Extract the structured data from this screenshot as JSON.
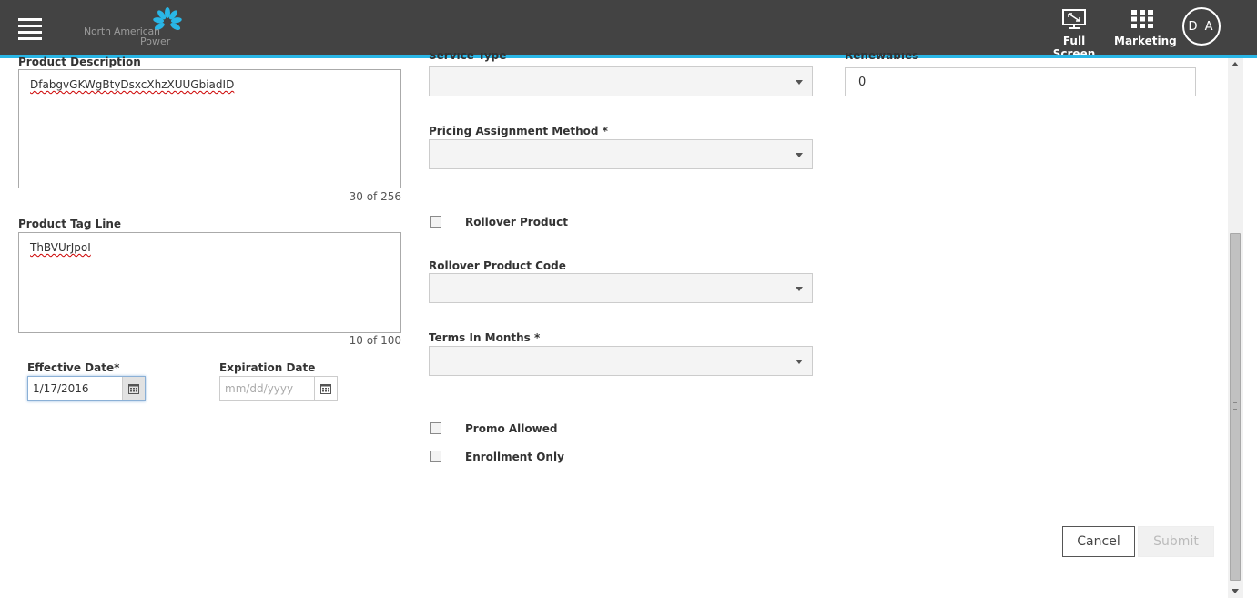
{
  "header": {
    "menu_icon": "hamburger-menu-icon",
    "logo": {
      "line1": "North American",
      "line2": "Power",
      "icon": "flower-burst-logo",
      "accent": "#29b6e6"
    },
    "fullscreen": {
      "label": "Full Screen",
      "icon": "monitor-fullscreen-icon"
    },
    "marketing": {
      "label": "Marketing",
      "icon": "grid-apps-icon"
    },
    "avatar": {
      "initials": "D A"
    },
    "bar_color": "#434343"
  },
  "form": {
    "product_description": {
      "label": "Product Description",
      "value": "DfabgvGKWgBtyDsxcXhzXUUGbiadID",
      "counter": "30 of 256"
    },
    "product_tag_line": {
      "label": "Product Tag Line",
      "value": "ThBVUrJpoI",
      "counter": "10 of 100"
    },
    "effective_date": {
      "label": "Effective Date*",
      "value": "1/17/2016",
      "icon": "calendar-icon"
    },
    "expiration_date": {
      "label": "Expiration Date",
      "placeholder": "mm/dd/yyyy",
      "icon": "calendar-icon"
    },
    "service_type": {
      "label": "Service Type",
      "value": ""
    },
    "pricing_assignment_method": {
      "label": "Pricing Assignment Method *",
      "value": ""
    },
    "rollover_product": {
      "label": "Rollover Product",
      "checked": false
    },
    "rollover_product_code": {
      "label": "Rollover Product Code",
      "value": ""
    },
    "terms_in_months": {
      "label": "Terms In Months *",
      "value": ""
    },
    "promo_allowed": {
      "label": "Promo Allowed",
      "checked": false
    },
    "enrollment_only": {
      "label": "Enrollment Only",
      "checked": false
    },
    "renewables": {
      "label": "Renewables",
      "value": "0"
    }
  },
  "actions": {
    "cancel": "Cancel",
    "submit": "Submit"
  }
}
